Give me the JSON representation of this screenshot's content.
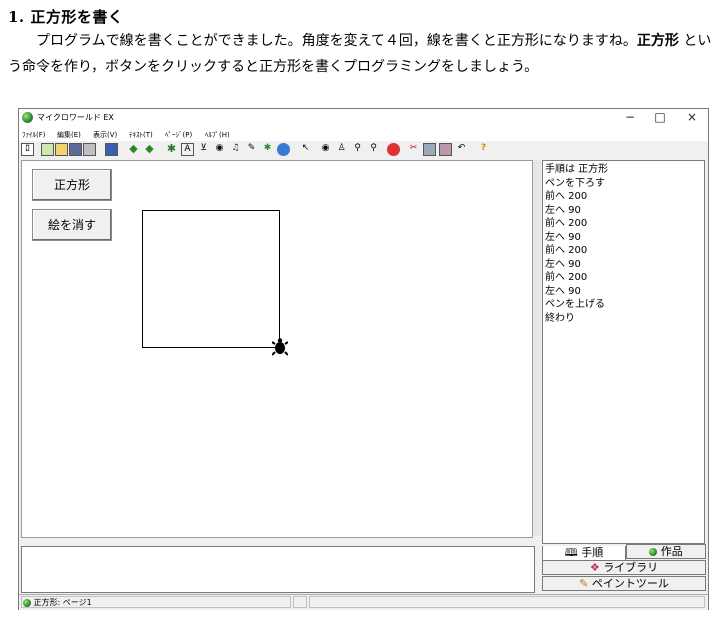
{
  "doc": {
    "title": "1. 正方形を書く",
    "para_part1": "プログラムで線を書くことができました。角度を変えて４回，線を書くと正方形になりますね。",
    "para_bold": "正方形",
    "para_part2": " という命令を作り，ボタンをクリックすると正方形を書くプログラミングをしましょう。"
  },
  "window": {
    "title": "マイクロワールド EX",
    "controls": {
      "minimize": "−",
      "maximize": "□",
      "close": "×"
    }
  },
  "menu": [
    "ﾌｧｲﾙ(F)",
    "編集(E)",
    "表示(V)",
    "ﾃｷｽﾄ(T)",
    "ﾍﾟｰｼﾞ(P)",
    "ﾍﾙﾌﾟ(H)"
  ],
  "toolbar_icons": [
    "page-icon",
    "new-icon",
    "open-icon",
    "save-icon",
    "print-icon",
    "info-icon",
    "back-icon",
    "forward-icon",
    "turtle-icon",
    "text-box-icon",
    "slider-icon",
    "eye-icon",
    "music-icon",
    "paint-icon",
    "shape-icon",
    "globe-icon",
    "pointer-icon",
    "eye-tool-icon",
    "stamp-icon",
    "zoom-in-icon",
    "zoom-out-icon",
    "stop-icon",
    "cut-icon",
    "copy-icon",
    "paste-icon",
    "undo-icon",
    "help-icon"
  ],
  "buttons": {
    "square": "正方形",
    "clear": "絵を消す"
  },
  "procedure": [
    "手順は 正方形",
    "ペンを下ろす",
    "前へ 200",
    "左へ 90",
    "前へ 200",
    "左へ 90",
    "前へ 200",
    "左へ 90",
    "前へ 200",
    "左へ 90",
    "ペンを上げる",
    "終わり"
  ],
  "tabs": {
    "procedures": "手順",
    "works": "作品",
    "library": "ライブラリ",
    "paint": "ペイントツール"
  },
  "status": {
    "page": "正方形: ページ1"
  }
}
